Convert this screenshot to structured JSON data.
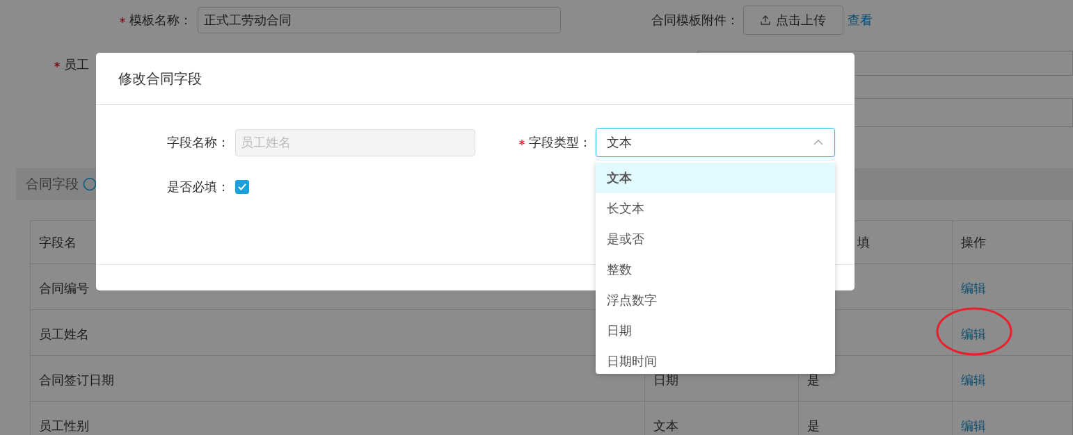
{
  "form": {
    "template_name": {
      "label": "模板名称：",
      "required": true,
      "value": "正式工劳动合同"
    },
    "attachment": {
      "label": "合同模板附件：",
      "upload_button": "点击上传",
      "view_link": "查看"
    },
    "signer": {
      "label": "员工",
      "required": true
    }
  },
  "section": {
    "title": "合同字段"
  },
  "table": {
    "columns": [
      {
        "label": "字段名"
      },
      {},
      {
        "label": "填"
      },
      {
        "label": "操作"
      }
    ],
    "rows": [
      {
        "name": "合同编号",
        "action": "编辑"
      },
      {
        "name": "员工姓名",
        "action": "编辑"
      },
      {
        "name": "合同签订日期",
        "type": "日期",
        "required": "是",
        "action": "编辑"
      },
      {
        "name": "员工性别",
        "type": "文本",
        "required": "是",
        "action": "编辑"
      }
    ]
  },
  "modal": {
    "title": "修改合同字段",
    "field_name": {
      "label": "字段名称：",
      "value": "员工姓名",
      "disabled": true
    },
    "field_type": {
      "label": "字段类型：",
      "required": true,
      "value": "文本",
      "expanded": true,
      "options": [
        {
          "label": "文本",
          "selected": true
        },
        {
          "label": "长文本",
          "selected": false
        },
        {
          "label": "是或否",
          "selected": false
        },
        {
          "label": "整数",
          "selected": false
        },
        {
          "label": "浮点数字",
          "selected": false
        },
        {
          "label": "日期",
          "selected": false
        },
        {
          "label": "日期时间",
          "selected": false
        }
      ]
    },
    "required_check": {
      "label": "是否必填：",
      "checked": true
    }
  },
  "annotation": {
    "kind": "circle",
    "color": "#e8202a"
  }
}
